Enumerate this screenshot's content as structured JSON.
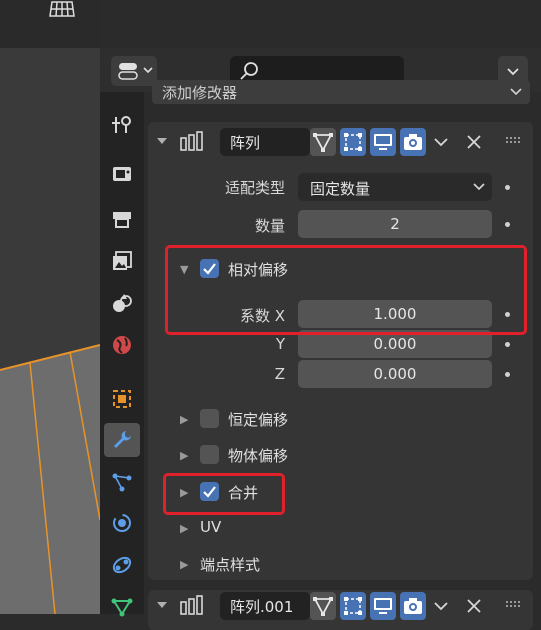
{
  "header": {
    "add_modifier": "添加修改器",
    "search_placeholder": ""
  },
  "modifier": {
    "name": "阵列",
    "fit_type_label": "适配类型",
    "fit_type_value": "固定数量",
    "count_label": "数量",
    "count_value": "2",
    "relative_offset": {
      "label": "相对偏移",
      "checked": true,
      "factor_x_label": "系数 X",
      "factor_x": "1.000",
      "y_label": "Y",
      "y": "0.000",
      "z_label": "Z",
      "z": "0.000"
    },
    "constant_offset": {
      "label": "恒定偏移",
      "checked": false
    },
    "object_offset": {
      "label": "物体偏移",
      "checked": false
    },
    "merge": {
      "label": "合并",
      "checked": true
    },
    "uv_label": "UV",
    "caps_label": "端点样式"
  },
  "modifier2": {
    "name": "阵列.001"
  },
  "colors": {
    "accent": "#4772b3",
    "highlight": "#e0202a"
  },
  "icons": [
    "grid-icon",
    "editor-type-icon",
    "search-icon",
    "chevron-down-icon",
    "tool-icon",
    "render-icon",
    "output-icon",
    "view-layer-icon",
    "scene-icon",
    "world-icon",
    "object-icon",
    "modifier-wrench-icon",
    "particles-icon",
    "physics-icon",
    "constraints-icon",
    "data-icon",
    "array-modifier-icon",
    "edit-mode-icon",
    "cage-icon",
    "realtime-icon",
    "render-camera-icon",
    "close-icon",
    "drag-handle-icon"
  ]
}
